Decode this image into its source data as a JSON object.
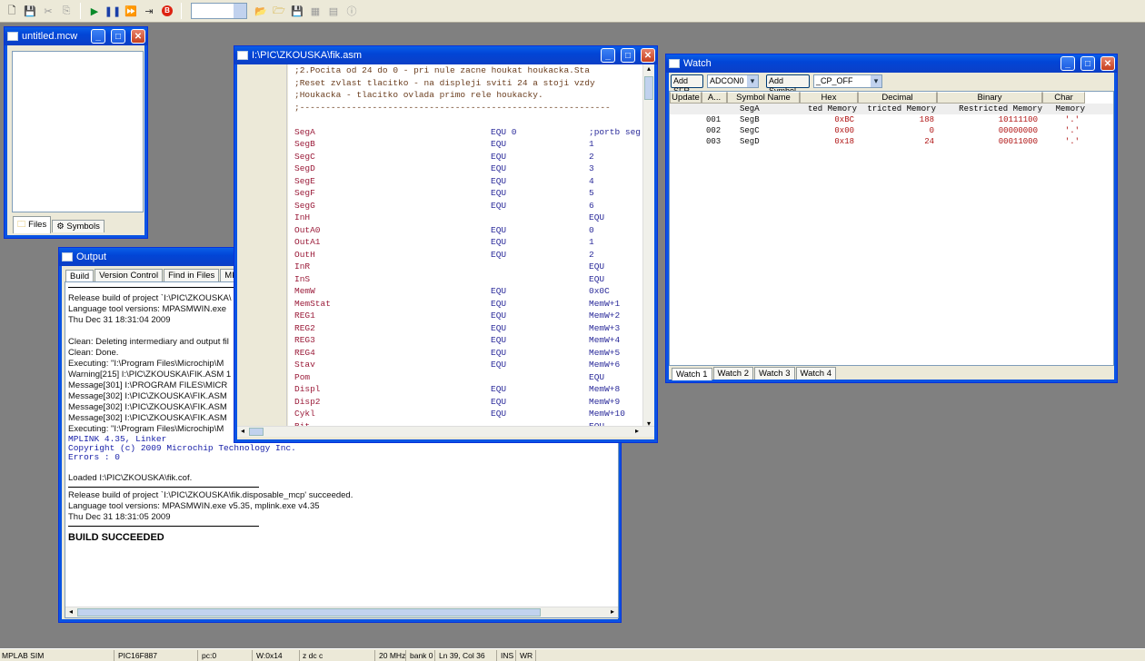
{
  "toolbar": {
    "icons": [
      "new-file-icon",
      "save-icon",
      "cut-icon",
      "copy-icon",
      "run-icon",
      "halt-icon",
      "animate-icon",
      "step-icon",
      "breakpoint-icon",
      "open-project-icon",
      "open-folder-icon",
      "save-project-icon",
      "build-icon",
      "info-icon"
    ]
  },
  "workspace": {
    "title": "untitled.mcw",
    "tabs": [
      "Files",
      "Symbols"
    ]
  },
  "output": {
    "title": "Output",
    "tabs": [
      "Build",
      "Version Control",
      "Find in Files",
      "MPLAB SIM"
    ],
    "lines": [
      {
        "t": "Release build of project `I:\\PIC\\ZKOUSKA\\",
        "s": "n"
      },
      {
        "t": "Language tool versions: MPASMWIN.exe",
        "s": "n"
      },
      {
        "t": "Thu Dec 31 18:31:04 2009",
        "s": "n"
      },
      {
        "t": "",
        "s": "n"
      },
      {
        "t": "Clean: Deleting intermediary and output fil",
        "s": "n"
      },
      {
        "t": "Clean: Done.",
        "s": "n"
      },
      {
        "t": "Executing: \"I:\\Program Files\\Microchip\\M",
        "s": "n"
      },
      {
        "t": "Warning[215] I:\\PIC\\ZKOUSKA\\FIK.ASM 1",
        "s": "n"
      },
      {
        "t": "Message[301] I:\\PROGRAM FILES\\MICR",
        "s": "n"
      },
      {
        "t": "Message[302] I:\\PIC\\ZKOUSKA\\FIK.ASM",
        "s": "n"
      },
      {
        "t": "Message[302] I:\\PIC\\ZKOUSKA\\FIK.ASM",
        "s": "n"
      },
      {
        "t": "Message[302] I:\\PIC\\ZKOUSKA\\FIK.ASM",
        "s": "n"
      },
      {
        "t": "Executing: \"I:\\Program Files\\Microchip\\M",
        "s": "n"
      },
      {
        "t": "MPLINK 4.35, Linker",
        "s": "b"
      },
      {
        "t": "Copyright (c) 2009 Microchip Technology Inc.",
        "s": "b"
      },
      {
        "t": "Errors    : 0",
        "s": "b"
      },
      {
        "t": "",
        "s": "n"
      },
      {
        "t": "Loaded I:\\PIC\\ZKOUSKA\\fik.cof.",
        "s": "n"
      }
    ],
    "lines2": [
      {
        "t": "Release build of project `I:\\PIC\\ZKOUSKA\\fik.disposable_mcp' succeeded."
      },
      {
        "t": "Language tool versions: MPASMWIN.exe v5.35, mplink.exe v4.35"
      },
      {
        "t": "Thu Dec 31 18:31:05 2009"
      }
    ],
    "result": "BUILD SUCCEEDED"
  },
  "editor": {
    "title": "I:\\PIC\\ZKOUSKA\\fik.asm",
    "comments": [
      ";2.Pocita od 24 do 0 - pri nule zacne houkat houkacka.Sta",
      ";Reset zvlast tlacitko - na displeji sviti 24 a stoji vzdy",
      ";Houkacka - tlacitko ovlada primo rele houkacky.",
      ";------------------------------------------------------------"
    ],
    "rows": [
      {
        "label": "",
        "a": "",
        "b": ""
      },
      {
        "label": "SegA",
        "a": "EQU 0",
        "b": ";portb seg"
      },
      {
        "label": "SegB",
        "a": "EQU",
        "b": "1"
      },
      {
        "label": "SegC",
        "a": "EQU",
        "b": "2"
      },
      {
        "label": "SegD",
        "a": "EQU",
        "b": "3"
      },
      {
        "label": "SegE",
        "a": "EQU",
        "b": "4"
      },
      {
        "label": "SegF",
        "a": "EQU",
        "b": "5"
      },
      {
        "label": "SegG",
        "a": "EQU",
        "b": "6"
      },
      {
        "label": "InH",
        "a": "",
        "b": "EQU"
      },
      {
        "label": "OutA0",
        "a": "EQU",
        "b": "0"
      },
      {
        "label": "OutA1",
        "a": "EQU",
        "b": "1"
      },
      {
        "label": "OutH",
        "a": "EQU",
        "b": "2"
      },
      {
        "label": "InR",
        "a": "",
        "b": "EQU"
      },
      {
        "label": "InS",
        "a": "",
        "b": "EQU"
      },
      {
        "label": "MemW",
        "a": "EQU",
        "b": "0x0C"
      },
      {
        "label": "MemStat",
        "a": "EQU",
        "b": "MemW+1"
      },
      {
        "label": "REG1",
        "a": "EQU",
        "b": "MemW+2"
      },
      {
        "label": "REG2",
        "a": "EQU",
        "b": "MemW+3"
      },
      {
        "label": "REG3",
        "a": "EQU",
        "b": "MemW+4"
      },
      {
        "label": "REG4",
        "a": "EQU",
        "b": "MemW+5"
      },
      {
        "label": "Stav",
        "a": "EQU",
        "b": "MemW+6"
      },
      {
        "label": "Pom",
        "a": "",
        "b": "EQU"
      },
      {
        "label": "Displ",
        "a": "EQU",
        "b": "MemW+8"
      },
      {
        "label": "Disp2",
        "a": "EQU",
        "b": "MemW+9"
      },
      {
        "label": "Cykl",
        "a": "EQU",
        "b": "MemW+10"
      },
      {
        "label": "Bit",
        "a": "",
        "b": "EQU"
      }
    ]
  },
  "watch": {
    "title": "Watch",
    "add_sfr": "Add SFR",
    "sfr_value": "ADCON0",
    "add_symbol": "Add Symbol",
    "symbol_value": "_CP_OFF",
    "headers": [
      "Update",
      "A...",
      "Symbol Name",
      "Hex",
      "Decimal",
      "Binary",
      "Char"
    ],
    "subheaders": [
      "SegA",
      "ted Memory",
      "tricted Memory",
      "Restricted Memory",
      "Memory"
    ],
    "rows": [
      {
        "addr": "001",
        "name": "SegB",
        "hex": "0xBC",
        "dec": "188",
        "bin": "10111100",
        "ch": "'.'"
      },
      {
        "addr": "002",
        "name": "SegC",
        "hex": "0x00",
        "dec": "0",
        "bin": "00000000",
        "ch": "'.'"
      },
      {
        "addr": "003",
        "name": "SegD",
        "hex": "0x18",
        "dec": "24",
        "bin": "00011000",
        "ch": "'.'"
      }
    ],
    "tabs": [
      "Watch 1",
      "Watch 2",
      "Watch 3",
      "Watch 4"
    ]
  },
  "status": {
    "cells": [
      "MPLAB SIM",
      "PIC16F887",
      "pc:0",
      "W:0x14",
      "z dc c",
      "20 MHz",
      "bank 0",
      "Ln 39, Col 36",
      "INS",
      "WR"
    ]
  }
}
